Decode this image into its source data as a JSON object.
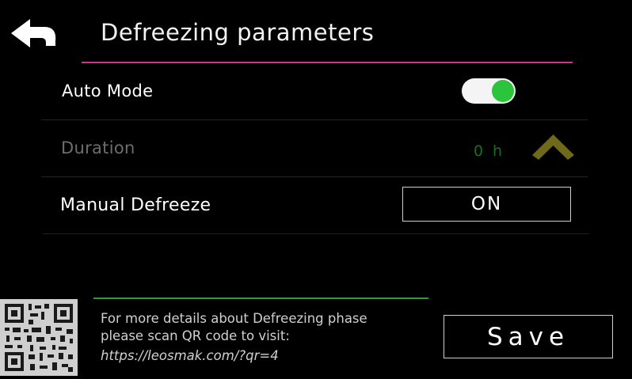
{
  "header": {
    "back_icon": "back-arrow-icon",
    "title": "Defreezing parameters",
    "title_rule_color": "#c8388a"
  },
  "auto_mode": {
    "label": "Auto Mode",
    "toggle_state": "on",
    "toggle_color": "#2cc43a"
  },
  "duration": {
    "label": "Duration",
    "value": "0",
    "unit": "h",
    "chevron_icon": "chevron-up-icon",
    "disabled": true
  },
  "manual_defreeze": {
    "label": "Manual Defreeze",
    "button_label": "ON"
  },
  "footer": {
    "qr_icon": "qr-code-icon",
    "info_line1": "For more details about Defreezing phase",
    "info_line2": "please scan QR code to visit:",
    "info_url": "https://leosmak.com/?qr=4",
    "save_label": "Save"
  }
}
